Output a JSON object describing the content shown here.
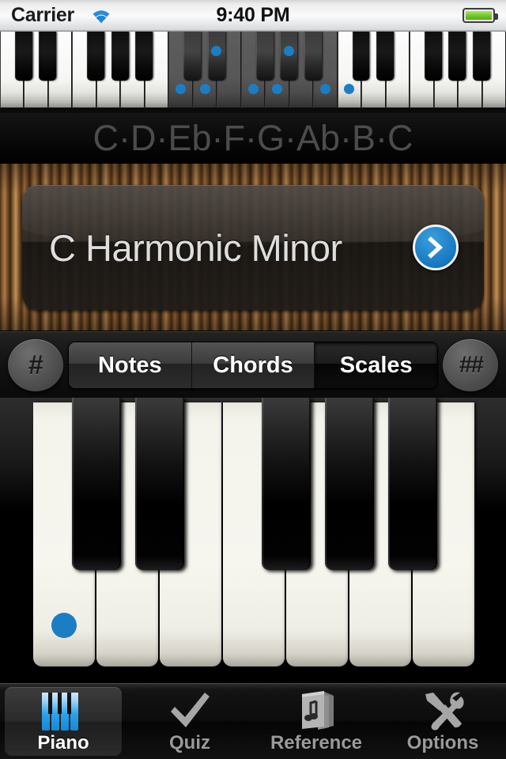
{
  "statusbar": {
    "carrier": "Carrier",
    "time": "9:40 PM",
    "wifi_icon": "wifi-icon",
    "battery_icon": "battery-icon"
  },
  "mini_keyboard": {
    "name": "mini-keyboard-overview",
    "highlight_color": "#1b7ec4",
    "total_white_keys": 21,
    "active_octave_start_white_index": 7,
    "active_octave_end_white_index": 14,
    "marked_white_indices": [
      7,
      8,
      10,
      11,
      13,
      14
    ],
    "marked_black_after_white_indices": [
      8,
      11
    ]
  },
  "scale_notes": {
    "label": "C·D·Eb·F·G·Ab·B·C",
    "notes": [
      "C",
      "D",
      "Eb",
      "F",
      "G",
      "Ab",
      "B",
      "C"
    ]
  },
  "scale_selector": {
    "title": "C Harmonic Minor",
    "disclosure_icon": "chevron-right-icon",
    "accent_color": "#1678c2"
  },
  "controls": {
    "flat_button": "#",
    "double_flat_button": "##",
    "segments": [
      {
        "label": "Notes",
        "selected": false
      },
      {
        "label": "Chords",
        "selected": false
      },
      {
        "label": "Scales",
        "selected": true
      }
    ]
  },
  "keyboard": {
    "name": "main-keyboard",
    "white_keys": [
      "C",
      "D",
      "E",
      "F",
      "G",
      "A",
      "B"
    ],
    "black_keys": [
      "C#",
      "D#",
      "F#",
      "G#",
      "A#"
    ],
    "marked_white_keys": [
      "C"
    ],
    "marked_black_keys": [],
    "dot_color": "#1b7ec4"
  },
  "tabbar": {
    "items": [
      {
        "label": "Piano",
        "icon": "piano-keys-icon",
        "selected": true
      },
      {
        "label": "Quiz",
        "icon": "checkmark-icon",
        "selected": false
      },
      {
        "label": "Reference",
        "icon": "book-music-icon",
        "selected": false
      },
      {
        "label": "Options",
        "icon": "hammer-wrench-icon",
        "selected": false
      }
    ]
  }
}
